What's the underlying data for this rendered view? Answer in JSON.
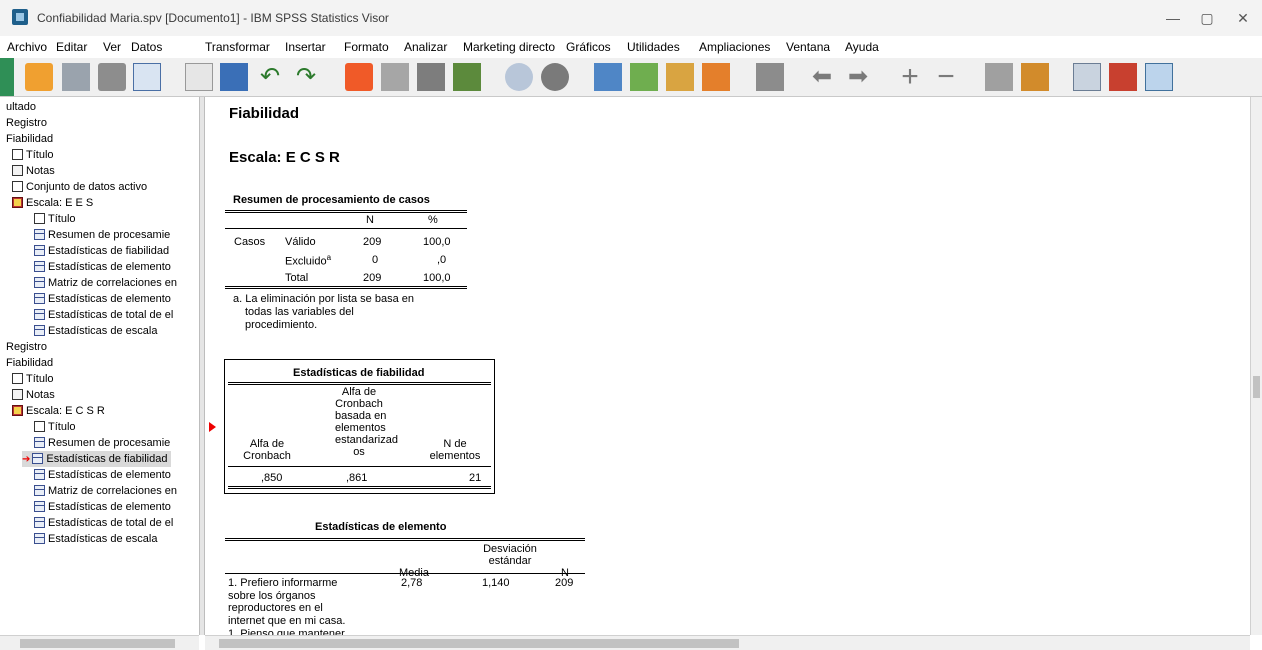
{
  "window": {
    "title": "Confiabilidad Maria.spv [Documento1] - IBM SPSS Statistics Visor"
  },
  "menu": [
    "Archivo",
    "Editar",
    "Ver",
    "Datos",
    "Transformar",
    "Insertar",
    "Formato",
    "Analizar",
    "Marketing directo",
    "Gráficos",
    "Utilidades",
    "Ampliaciones",
    "Ventana",
    "Ayuda"
  ],
  "outline": [
    {
      "label": "ultado",
      "icon": "none",
      "level": 0
    },
    {
      "label": "Registro",
      "icon": "none",
      "level": 0
    },
    {
      "label": "Fiabilidad",
      "icon": "none",
      "level": 0
    },
    {
      "label": "Título",
      "icon": "doc-icon",
      "level": 1
    },
    {
      "label": "Notas",
      "icon": "notes-icon",
      "level": 1
    },
    {
      "label": "Conjunto de datos activo",
      "icon": "doc-icon",
      "level": 1
    },
    {
      "label": "Escala: E E S",
      "icon": "book-icon",
      "level": 1
    },
    {
      "label": "Título",
      "icon": "doc-icon",
      "level": 2
    },
    {
      "label": "Resumen de procesamie",
      "icon": "table-icon",
      "level": 2
    },
    {
      "label": "Estadísticas de fiabilidad",
      "icon": "table-icon",
      "level": 2
    },
    {
      "label": "Estadísticas de elemento",
      "icon": "table-icon",
      "level": 2
    },
    {
      "label": "Matriz de correlaciones en",
      "icon": "table-icon",
      "level": 2
    },
    {
      "label": "Estadísticas de elemento",
      "icon": "table-icon",
      "level": 2
    },
    {
      "label": "Estadísticas de total de el",
      "icon": "table-icon",
      "level": 2
    },
    {
      "label": "Estadísticas de escala",
      "icon": "table-icon",
      "level": 2
    },
    {
      "label": "Registro",
      "icon": "none",
      "level": 0
    },
    {
      "label": "Fiabilidad",
      "icon": "none",
      "level": 0
    },
    {
      "label": "Título",
      "icon": "doc-icon",
      "level": 1
    },
    {
      "label": "Notas",
      "icon": "notes-icon",
      "level": 1
    },
    {
      "label": "Escala: E C S R",
      "icon": "book-icon",
      "level": 1
    },
    {
      "label": "Título",
      "icon": "doc-icon",
      "level": 2
    },
    {
      "label": "Resumen de procesamie",
      "icon": "table-icon",
      "level": 2
    },
    {
      "label": "Estadísticas de fiabilidad",
      "icon": "table-icon",
      "level": 2,
      "selected": true
    },
    {
      "label": "Estadísticas de elemento",
      "icon": "table-icon",
      "level": 2
    },
    {
      "label": "Matriz de correlaciones en",
      "icon": "table-icon",
      "level": 2
    },
    {
      "label": "Estadísticas de elemento",
      "icon": "table-icon",
      "level": 2
    },
    {
      "label": "Estadísticas de total de el",
      "icon": "table-icon",
      "level": 2
    },
    {
      "label": "Estadísticas de escala",
      "icon": "table-icon",
      "level": 2
    }
  ],
  "output": {
    "heading": "Fiabilidad",
    "scale": "Escala: E C S R",
    "case_summary": {
      "title": "Resumen de procesamiento de casos",
      "col_n": "N",
      "col_pct": "%",
      "group": "Casos",
      "rows": [
        {
          "label": "Válido",
          "sup": "",
          "n": "209",
          "pct": "100,0"
        },
        {
          "label": "Excluido",
          "sup": "a",
          "n": "0",
          "pct": ",0"
        },
        {
          "label": "Total",
          "sup": "",
          "n": "209",
          "pct": "100,0"
        }
      ],
      "footnote_lines": [
        "a. La eliminación por lista se basa en",
        "todas las variables del",
        "procedimiento."
      ]
    },
    "reliability": {
      "title": "Estadísticas de fiabilidad",
      "col1_lines": [
        "Alfa de",
        "Cronbach"
      ],
      "col2_lines": [
        "Alfa de",
        "Cronbach",
        "basada en",
        "elementos",
        "estandarizad",
        "os"
      ],
      "col3_lines": [
        "N de",
        "elementos"
      ],
      "values": [
        ",850",
        ",861",
        "21"
      ]
    },
    "item_stats": {
      "title": "Estadísticas de elemento",
      "col_media": "Media",
      "col_desv_lines": [
        "Desviación",
        "estándar"
      ],
      "col_n": "N",
      "row1_label_lines": [
        "1. Prefiero informarme",
        "sobre los órganos",
        "reproductores en el",
        "internet que en mi casa."
      ],
      "row1": {
        "media": "2,78",
        "desv": "1,140",
        "n": "209"
      },
      "row2_partial": "1. Pienso que mantener"
    }
  }
}
